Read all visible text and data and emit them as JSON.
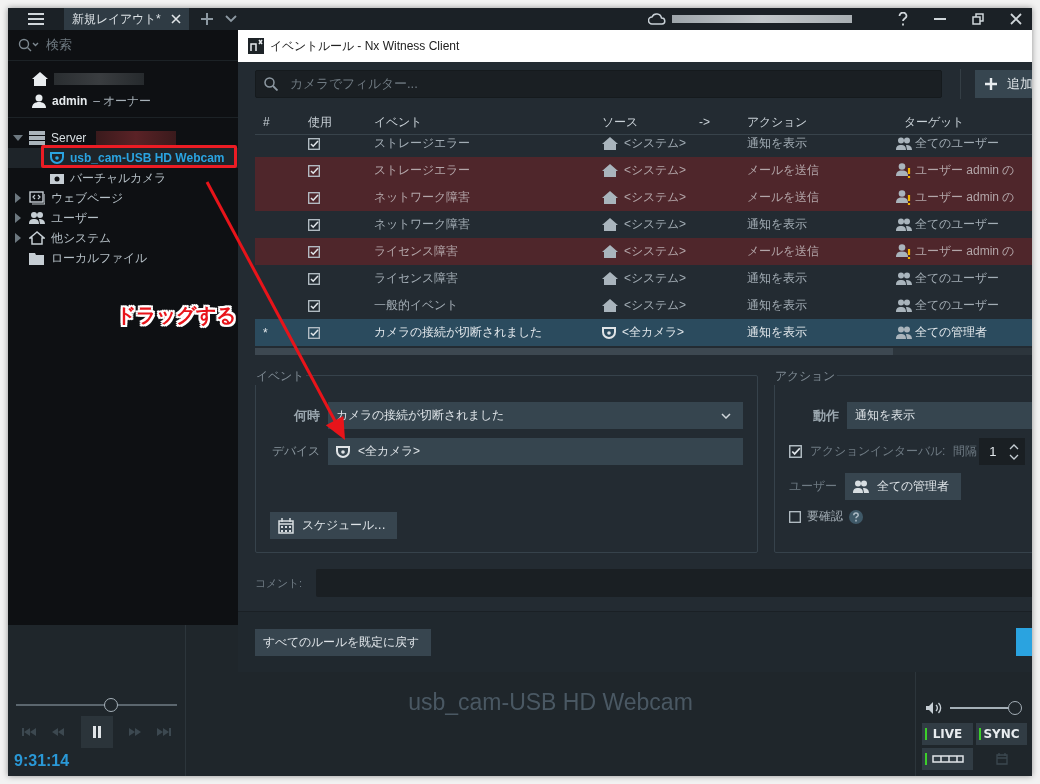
{
  "top_bar": {
    "tabs": [
      {
        "label": "新規レイアウト*",
        "selected": true
      }
    ]
  },
  "sidebar": {
    "search": {
      "placeholder": "検索"
    },
    "user": {
      "name": "admin",
      "role": "– オーナー"
    },
    "tree": [
      {
        "label": "Server",
        "kind": "server",
        "expanded": true,
        "selected": false,
        "children": [
          {
            "label": "usb_cam-USB HD Webcam",
            "kind": "camera",
            "selected": true
          },
          {
            "label": "バーチャルカメラ",
            "kind": "virtual-camera",
            "selected": false
          }
        ]
      },
      {
        "label": "ウェブページ",
        "kind": "webpage",
        "expanded": false,
        "selected": false
      },
      {
        "label": "ユーザー",
        "kind": "users",
        "expanded": false,
        "selected": false
      },
      {
        "label": "他システム",
        "kind": "systems",
        "expanded": false,
        "selected": false
      },
      {
        "label": "ローカルファイル",
        "kind": "folder",
        "selected": false
      }
    ]
  },
  "dialog": {
    "title": "イベントルール - Nx Witness Client",
    "filter": {
      "placeholder": "カメラでフィルター..."
    },
    "add_button": "追加",
    "table": {
      "columns": [
        "#",
        "使用",
        "イベント",
        "ソース",
        "->",
        "アクション",
        "ターゲット"
      ],
      "rows": [
        {
          "enabled": true,
          "event": "ストレージエラー",
          "source": {
            "kind": "system",
            "label": "<システム>"
          },
          "action": "通知を表示",
          "target": {
            "kind": "users",
            "label": "全てのユーザー"
          },
          "warning": false,
          "selected": false
        },
        {
          "enabled": true,
          "event": "ストレージエラー",
          "source": {
            "kind": "system",
            "label": "<システム>"
          },
          "action": "メールを送信",
          "target": {
            "kind": "user-warning",
            "label": "ユーザー admin の"
          },
          "warning": true,
          "selected": false
        },
        {
          "enabled": true,
          "event": "ネットワーク障害",
          "source": {
            "kind": "system",
            "label": "<システム>"
          },
          "action": "メールを送信",
          "target": {
            "kind": "user-warning",
            "label": "ユーザー admin の"
          },
          "warning": true,
          "selected": false
        },
        {
          "enabled": true,
          "event": "ネットワーク障害",
          "source": {
            "kind": "system",
            "label": "<システム>"
          },
          "action": "通知を表示",
          "target": {
            "kind": "users",
            "label": "全てのユーザー"
          },
          "warning": false,
          "selected": false
        },
        {
          "enabled": true,
          "event": "ライセンス障害",
          "source": {
            "kind": "system",
            "label": "<システム>"
          },
          "action": "メールを送信",
          "target": {
            "kind": "user-warning",
            "label": "ユーザー admin の"
          },
          "warning": true,
          "selected": false
        },
        {
          "enabled": true,
          "event": "ライセンス障害",
          "source": {
            "kind": "system",
            "label": "<システム>"
          },
          "action": "通知を表示",
          "target": {
            "kind": "users",
            "label": "全てのユーザー"
          },
          "warning": false,
          "selected": false
        },
        {
          "enabled": true,
          "event": "一般的イベント",
          "source": {
            "kind": "system",
            "label": "<システム>"
          },
          "action": "通知を表示",
          "target": {
            "kind": "users",
            "label": "全てのユーザー"
          },
          "warning": false,
          "selected": false
        },
        {
          "marker": "*",
          "enabled": true,
          "event": "カメラの接続が切断されました",
          "source": {
            "kind": "camera",
            "label": "<全カメラ>"
          },
          "action": "通知を表示",
          "target": {
            "kind": "users",
            "label": "全ての管理者"
          },
          "warning": false,
          "selected": true
        }
      ]
    },
    "event_group": {
      "title": "イベント",
      "when_label": "何時",
      "when_value": "カメラの接続が切断されました",
      "device_label": "デバイス",
      "device_value": "<全カメラ>",
      "schedule_button": "スケジュール..."
    },
    "action_group": {
      "title": "アクション",
      "action_label": "動作",
      "action_value": "通知を表示",
      "interval": {
        "checked": true,
        "label": "アクションインターバル:",
        "unit_label": "間隔",
        "value": "1"
      },
      "users_label": "ユーザー",
      "users_button": "全ての管理者",
      "confirm": {
        "checked": false,
        "label": "要確認"
      }
    },
    "comment_label": "コメント:",
    "reset_button": "すべてのルールを既定に戻す"
  },
  "player": {
    "position": {
      "level": 0.59
    },
    "time": "9:31:14",
    "camera_title": "usb_cam-USB HD Webcam",
    "volume": {
      "level": 0.93
    },
    "live_button": {
      "label": "LIVE",
      "on": true
    },
    "sync_button": {
      "label": "SYNC",
      "on": true
    },
    "timeline_button": {
      "on": true
    }
  },
  "annotation": {
    "label": "ドラッグする"
  }
}
